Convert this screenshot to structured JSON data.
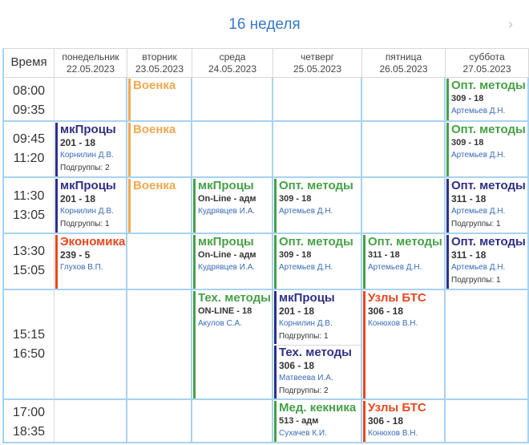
{
  "header": {
    "week_title": "16 неделя",
    "next_icon": "chevron-right-icon"
  },
  "table": {
    "time_header": "Время",
    "days": [
      {
        "name": "понедельник",
        "date": "22.05.2023"
      },
      {
        "name": "вторник",
        "date": "23.05.2023"
      },
      {
        "name": "среда",
        "date": "24.05.2023"
      },
      {
        "name": "четверг",
        "date": "25.05.2023"
      },
      {
        "name": "пятница",
        "date": "26.05.2023"
      },
      {
        "name": "суббота",
        "date": "27.05.2023"
      }
    ],
    "times": [
      {
        "start": "08:00",
        "end": "09:35"
      },
      {
        "start": "09:45",
        "end": "11:20"
      },
      {
        "start": "11:30",
        "end": "13:05"
      },
      {
        "start": "13:30",
        "end": "15:05"
      },
      {
        "start": "15:15",
        "end": "16:50"
      },
      {
        "start": "17:00",
        "end": "18:35"
      }
    ]
  },
  "colors": {
    "blue": "#2f2f86",
    "orange": "#f0a850",
    "green": "#46a047",
    "red": "#e8471e",
    "grid": "#a7d2f0",
    "title": "#3a78c8"
  },
  "lessons": {
    "tue_p1": {
      "subject": "Военка"
    },
    "sat_p1": {
      "subject": "Опт. методы",
      "room": "309 - 18",
      "teacher": "Артемьев Д.Н."
    },
    "mon_p2": {
      "subject": "мкПроцы",
      "room": "201 - 18",
      "teacher": "Корнилин Д.В.",
      "groups": "Подгруппы: 2"
    },
    "tue_p2": {
      "subject": "Военка"
    },
    "sat_p2": {
      "subject": "Опт. методы",
      "room": "309 - 18",
      "teacher": "Артемьев Д.Н."
    },
    "mon_p3": {
      "subject": "мкПроцы",
      "room": "201 - 18",
      "teacher": "Корнилин Д.В.",
      "groups": "Подгруппы: 1"
    },
    "tue_p3": {
      "subject": "Военка"
    },
    "wed_p3": {
      "subject": "мкПроцы",
      "room": "On-Line - адм",
      "teacher": "Кудрявцев И.А."
    },
    "thu_p3": {
      "subject": "Опт. методы",
      "room": "309 - 18",
      "teacher": "Артемьев Д.Н."
    },
    "sat_p3": {
      "subject": "Опт. методы",
      "room": "311 - 18",
      "teacher": "Артемьев Д.Н.",
      "groups": "Подгруппы: 1"
    },
    "mon_p4": {
      "subject": "Экономика",
      "room": "239 - 5",
      "teacher": "Глухов В.П."
    },
    "wed_p4": {
      "subject": "мкПроцы",
      "room": "On-Line - адм",
      "teacher": "Кудрявцев И.А."
    },
    "thu_p4": {
      "subject": "Опт. методы",
      "room": "309 - 18",
      "teacher": "Артемьев Д.Н."
    },
    "fri_p4": {
      "subject": "Опт. методы",
      "room": "311 - 18",
      "teacher": "Артемьев Д.Н."
    },
    "sat_p4": {
      "subject": "Опт. методы",
      "room": "311 - 18",
      "teacher": "Артемьев Д.Н.",
      "groups": "Подгруппы: 1"
    },
    "wed_p5": {
      "subject": "Тех. методы",
      "room": "ON-LINE - 18",
      "teacher": "Акулов С.А."
    },
    "thu_p5a": {
      "subject": "мкПроцы",
      "room": "201 - 18",
      "teacher": "Корнилин Д.В.",
      "groups": "Подгруппы: 1"
    },
    "thu_p5b": {
      "subject": "Тех. методы",
      "room": "306 - 18",
      "teacher": "Матвеева И.А.",
      "groups": "Подгруппы: 2"
    },
    "fri_p5": {
      "subject": "Узлы БТС",
      "room": "306 - 18",
      "teacher": "Конюхов В.Н."
    },
    "thu_p6": {
      "subject": "Мед. кекника",
      "room": "513 - адм",
      "teacher": "Сухачев К.И."
    },
    "fri_p6": {
      "subject": "Узлы БТС",
      "room": "306 - 18",
      "teacher": "Конюхов В.Н."
    }
  }
}
